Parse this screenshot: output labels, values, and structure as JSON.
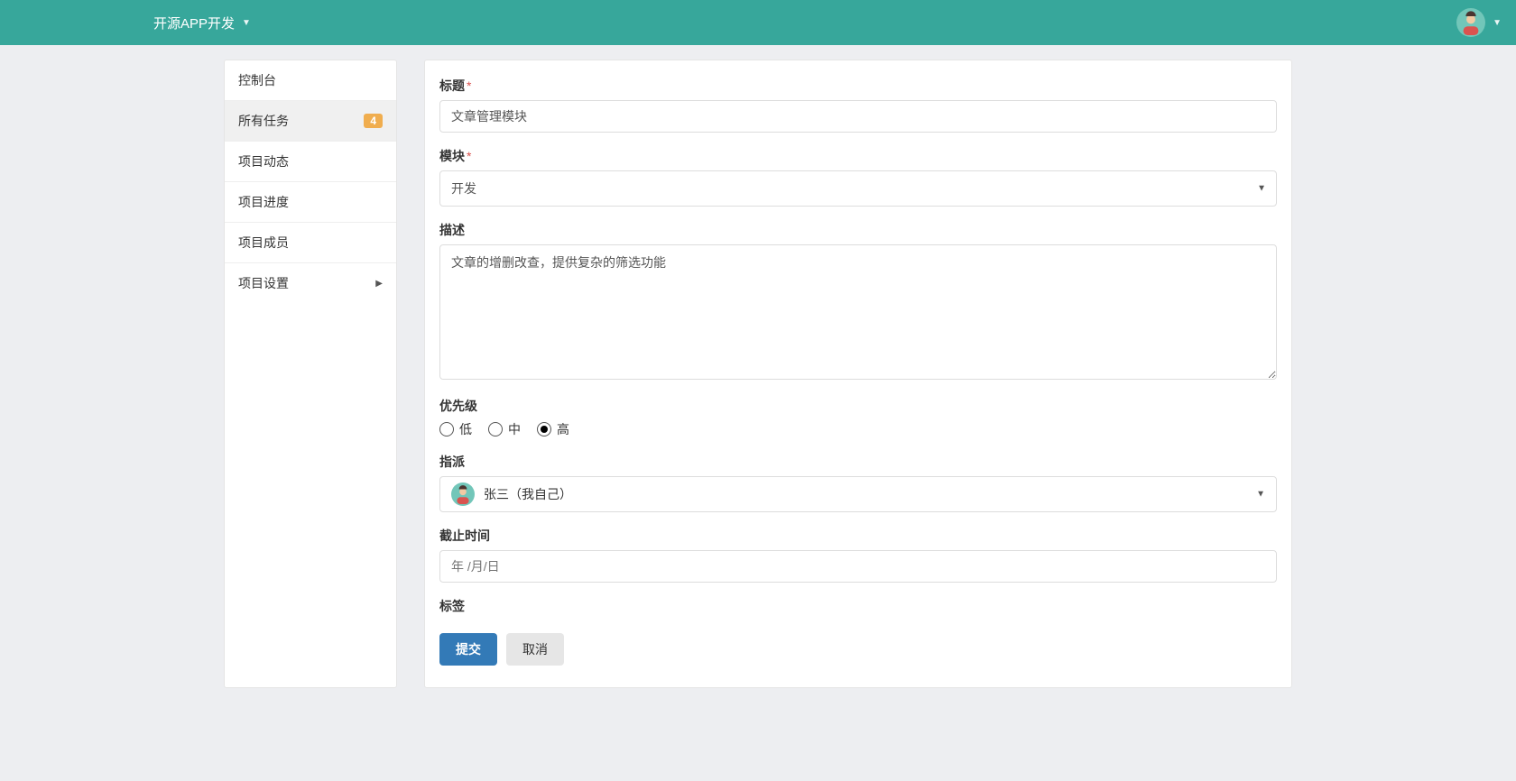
{
  "topbar": {
    "title": "开源APP开发"
  },
  "sidebar": {
    "items": [
      {
        "label": "控制台",
        "active": false
      },
      {
        "label": "所有任务",
        "active": true,
        "badge": "4"
      },
      {
        "label": "项目动态",
        "active": false
      },
      {
        "label": "项目进度",
        "active": false
      },
      {
        "label": "项目成员",
        "active": false
      },
      {
        "label": "项目设置",
        "active": false,
        "arrow": true
      }
    ]
  },
  "form": {
    "labels": {
      "title": "标题",
      "module": "模块",
      "description": "描述",
      "priority": "优先级",
      "assign": "指派",
      "deadline": "截止时间",
      "tags": "标签"
    },
    "title_value": "文章管理模块",
    "module_value": "开发",
    "description_value": "文章的增删改查，提供复杂的筛选功能",
    "priority_options": {
      "low": "低",
      "mid": "中",
      "high": "高"
    },
    "priority_selected": "high",
    "assignee": "张三（我自己）",
    "deadline_placeholder": "年 /月/日"
  },
  "buttons": {
    "submit": "提交",
    "cancel": "取消"
  }
}
